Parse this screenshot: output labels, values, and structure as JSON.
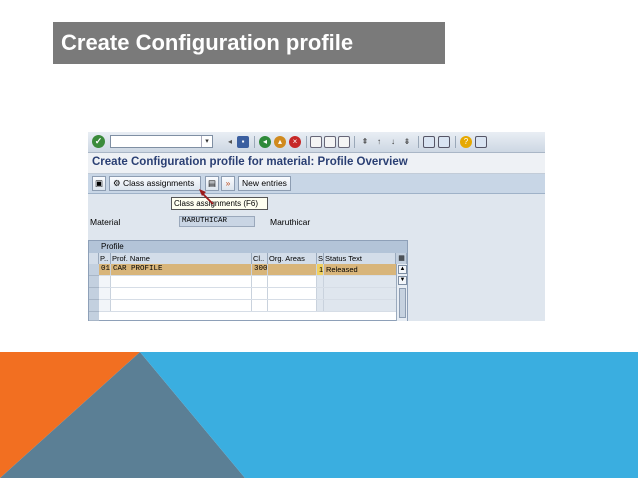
{
  "slide": {
    "title": "Create Configuration profile",
    "colors": {
      "title_bg": "#7a7a7a",
      "orange": "#f26f21",
      "blue": "#3aaee0",
      "slate": "#5b7f95"
    }
  },
  "sap": {
    "window_title": "Create Configuration profile for material: Profile Overview",
    "toolbar": {
      "class_assignments_label": "Class assignments",
      "new_entries_label": "New entries",
      "icons": [
        "ok-icon",
        "save-icon",
        "back-icon",
        "exit-icon",
        "cancel-icon",
        "print-icon",
        "find-icon",
        "first-page-icon",
        "last-page-icon",
        "session-icon",
        "shortcut-icon",
        "help-icon",
        "layout-icon"
      ]
    },
    "tooltip": "Class assignments   (F6)",
    "material": {
      "label": "Material",
      "value": "MARUTHICAR",
      "description": "Maruthicar"
    },
    "table": {
      "title": "Profile",
      "headers": {
        "p": "P..",
        "prof_name": "Prof. Name",
        "cl": "Cl..",
        "org_areas": "Org. Areas",
        "s": "S",
        "status_text": "Status Text"
      },
      "rows": [
        {
          "p": "01",
          "prof_name": "CAR PROFILE",
          "cl": "300",
          "org_areas": "",
          "s": "1",
          "status_text": "Released"
        }
      ]
    }
  }
}
